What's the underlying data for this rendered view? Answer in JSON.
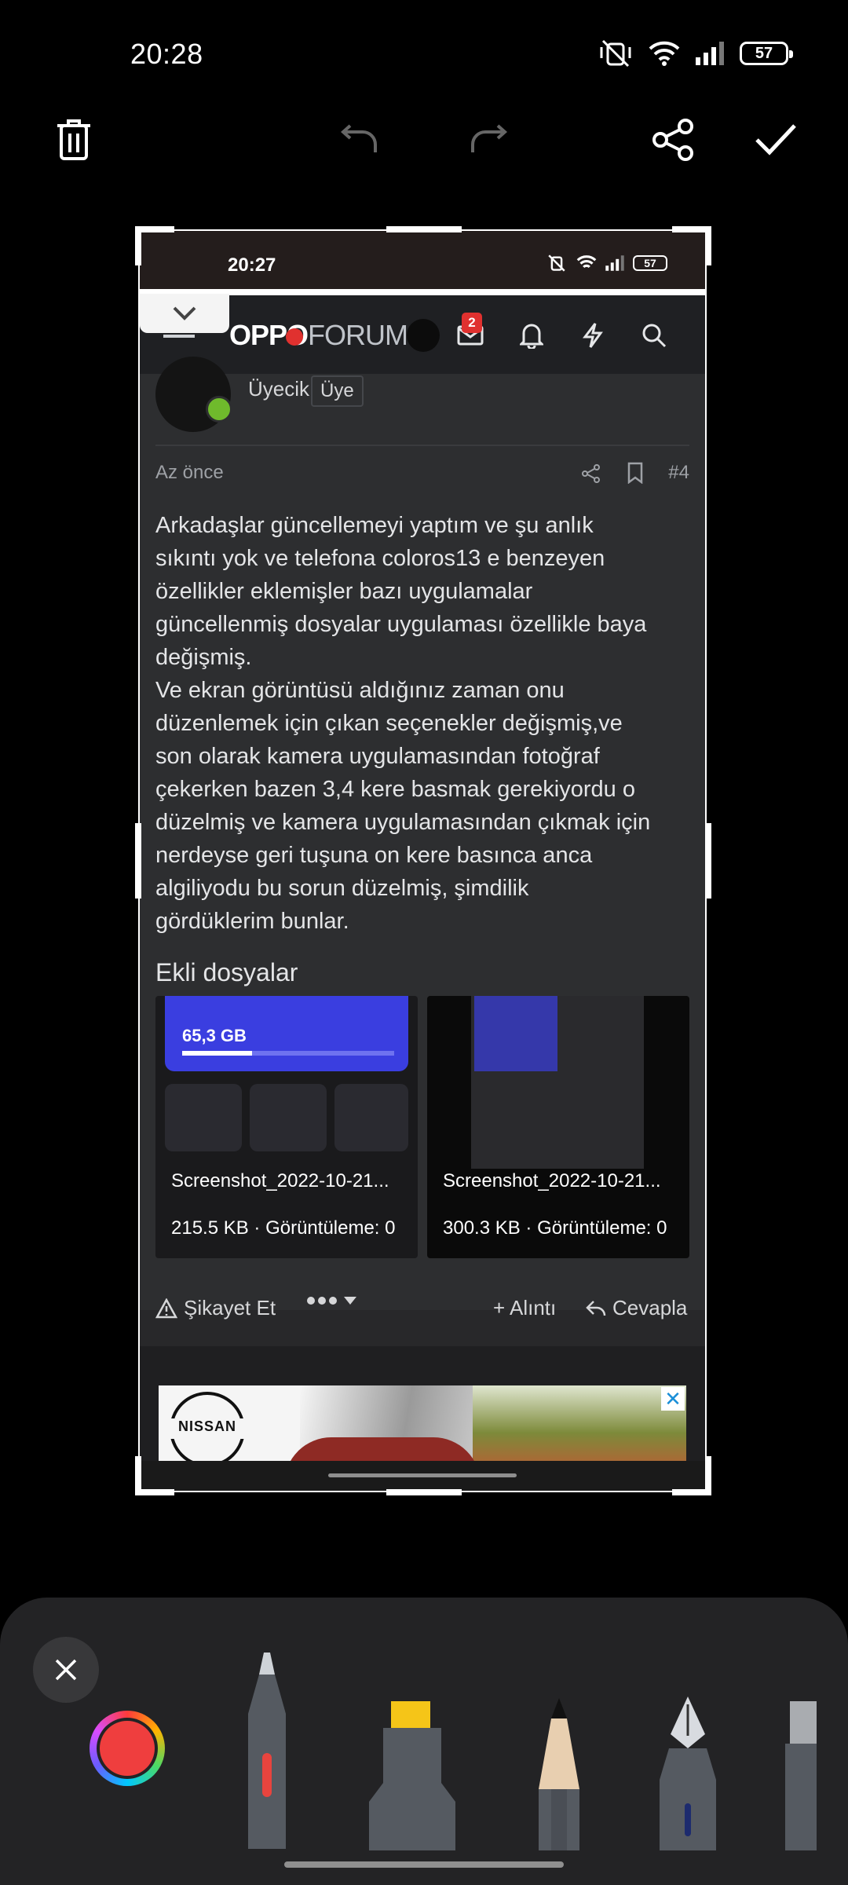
{
  "status_bar": {
    "time": "20:28",
    "battery": "57"
  },
  "editor_toolbar": {
    "delete_icon": "trash-icon",
    "undo_icon": "undo-icon",
    "redo_icon": "redo-icon",
    "share_icon": "share-icon",
    "confirm_icon": "check-icon"
  },
  "screenshot": {
    "status_time": "20:27",
    "battery": "57",
    "header": {
      "logo_oppo": "OPPO",
      "logo_forum": "FORUM",
      "message_count": "2"
    },
    "post": {
      "role": "Üyecik",
      "role_tag": "Üye",
      "date": "Az önce",
      "post_number": "#4",
      "body": "Arkadaşlar güncellemeyi yaptım ve şu anlık\nsıkıntı yok ve telefona coloros13 e benzeyen\nözellikler eklemişler bazı uygulamalar\ngüncellenmiş dosyalar uygulaması özellikle baya\ndeğişmiş.\nVe ekran görüntüsü aldığınız zaman onu\ndüzenlemek için çıkan seçenekler değişmiş,ve\nson olarak kamera uygulamasından fotoğraf\nçekerken bazen 3,4 kere basmak gerekiyordu o\ndüzelmiş ve kamera uygulamasından çıkmak için\nnerdeyse geri tuşuna on kere basınca anca\nalgiliyodu bu sorun düzelmiş, şimdilik\ngördüklerim bunlar.",
      "attachments_heading": "Ekli dosyalar",
      "attachments": [
        {
          "name": "Screenshot_2022-10-21...",
          "meta": "215.5 KB · Görüntüleme: 0",
          "preview_value": "65,3 GB"
        },
        {
          "name": "Screenshot_2022-10-21...",
          "meta": "300.3 KB · Görüntüleme: 0"
        }
      ],
      "report_label": "Şikayet Et",
      "quote_label": "+ Alıntı",
      "reply_label": "Cevapla"
    },
    "ad": {
      "brand": "NISSAN",
      "close": "✕"
    }
  },
  "tools": {
    "close_icon": "close-icon",
    "selected_color": "#ef3e3e",
    "items": [
      "ballpoint-pen",
      "highlighter",
      "pencil",
      "fountain-pen",
      "eraser"
    ]
  },
  "colors": {
    "background": "#000000",
    "panel": "#232325",
    "post_bg": "#2d2e30",
    "accent_red": "#e0312f"
  }
}
